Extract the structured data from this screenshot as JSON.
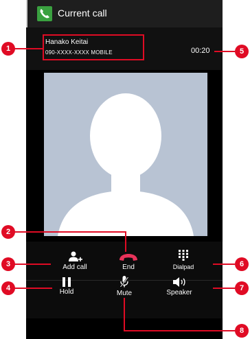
{
  "header": {
    "title": "Current call"
  },
  "call": {
    "name": "Hanako Keitai",
    "number": "090-XXXX-XXXX  MOBILE",
    "duration": "00:20"
  },
  "controls": {
    "add_call": "Add call",
    "end": "End",
    "dialpad": "Dialpad",
    "hold": "Hold",
    "mute": "Mute",
    "speaker": "Speaker"
  },
  "callouts": [
    "1",
    "2",
    "3",
    "4",
    "5",
    "6",
    "7",
    "8"
  ],
  "colors": {
    "accent_red": "#e00b24",
    "end_red": "#e8335a",
    "photo_bg": "#b8c3d3",
    "app_icon_green": "#3aa140"
  },
  "icons": [
    "phone-app-icon",
    "add-person-icon",
    "end-call-icon",
    "dialpad-icon",
    "pause-icon",
    "mic-mute-icon",
    "speaker-icon",
    "contact-silhouette-icon"
  ]
}
